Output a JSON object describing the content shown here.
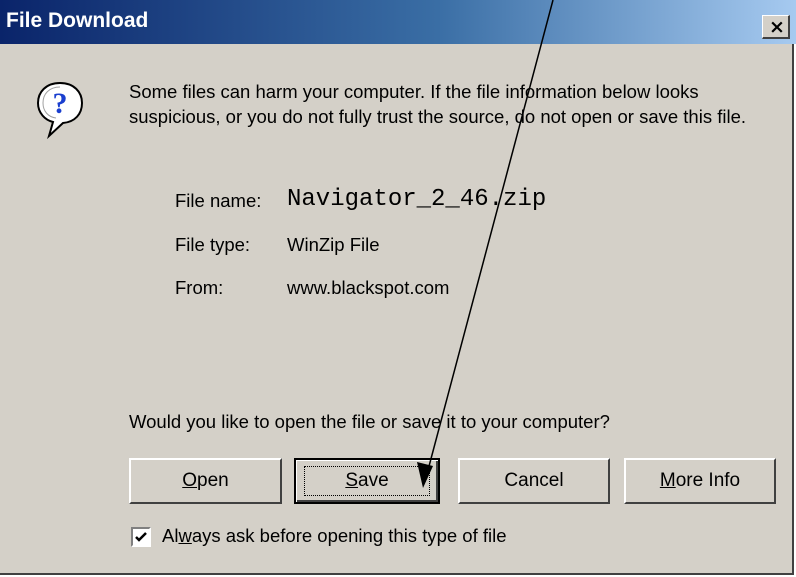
{
  "dialog": {
    "title": "File Download",
    "close_glyph": "×"
  },
  "icon": {
    "name": "question-icon",
    "glyph": "?"
  },
  "message": "Some files can harm your computer. If the file information below looks suspicious, or you do not fully trust the source, do not open or save this file.",
  "file": {
    "name_label": "File name:",
    "name_value": "Navigator_2_46.zip",
    "type_label": "File type:",
    "type_value": "WinZip File",
    "from_label": "From:",
    "from_value": "www.blackspot.com"
  },
  "question": "Would you like to open the file or save it to your computer?",
  "buttons": {
    "open": {
      "mnemonic": "O",
      "rest": "pen"
    },
    "save": {
      "mnemonic": "S",
      "rest": "ave"
    },
    "cancel": {
      "label": "Cancel"
    },
    "more_info": {
      "mnemonic": "M",
      "rest": "ore Info"
    }
  },
  "checkbox": {
    "checked": true,
    "label_pre": "Al",
    "mnemonic": "w",
    "label_post": "ays ask before opening this type of file"
  },
  "annotation": {
    "kind": "arrow",
    "color": "#000000"
  }
}
